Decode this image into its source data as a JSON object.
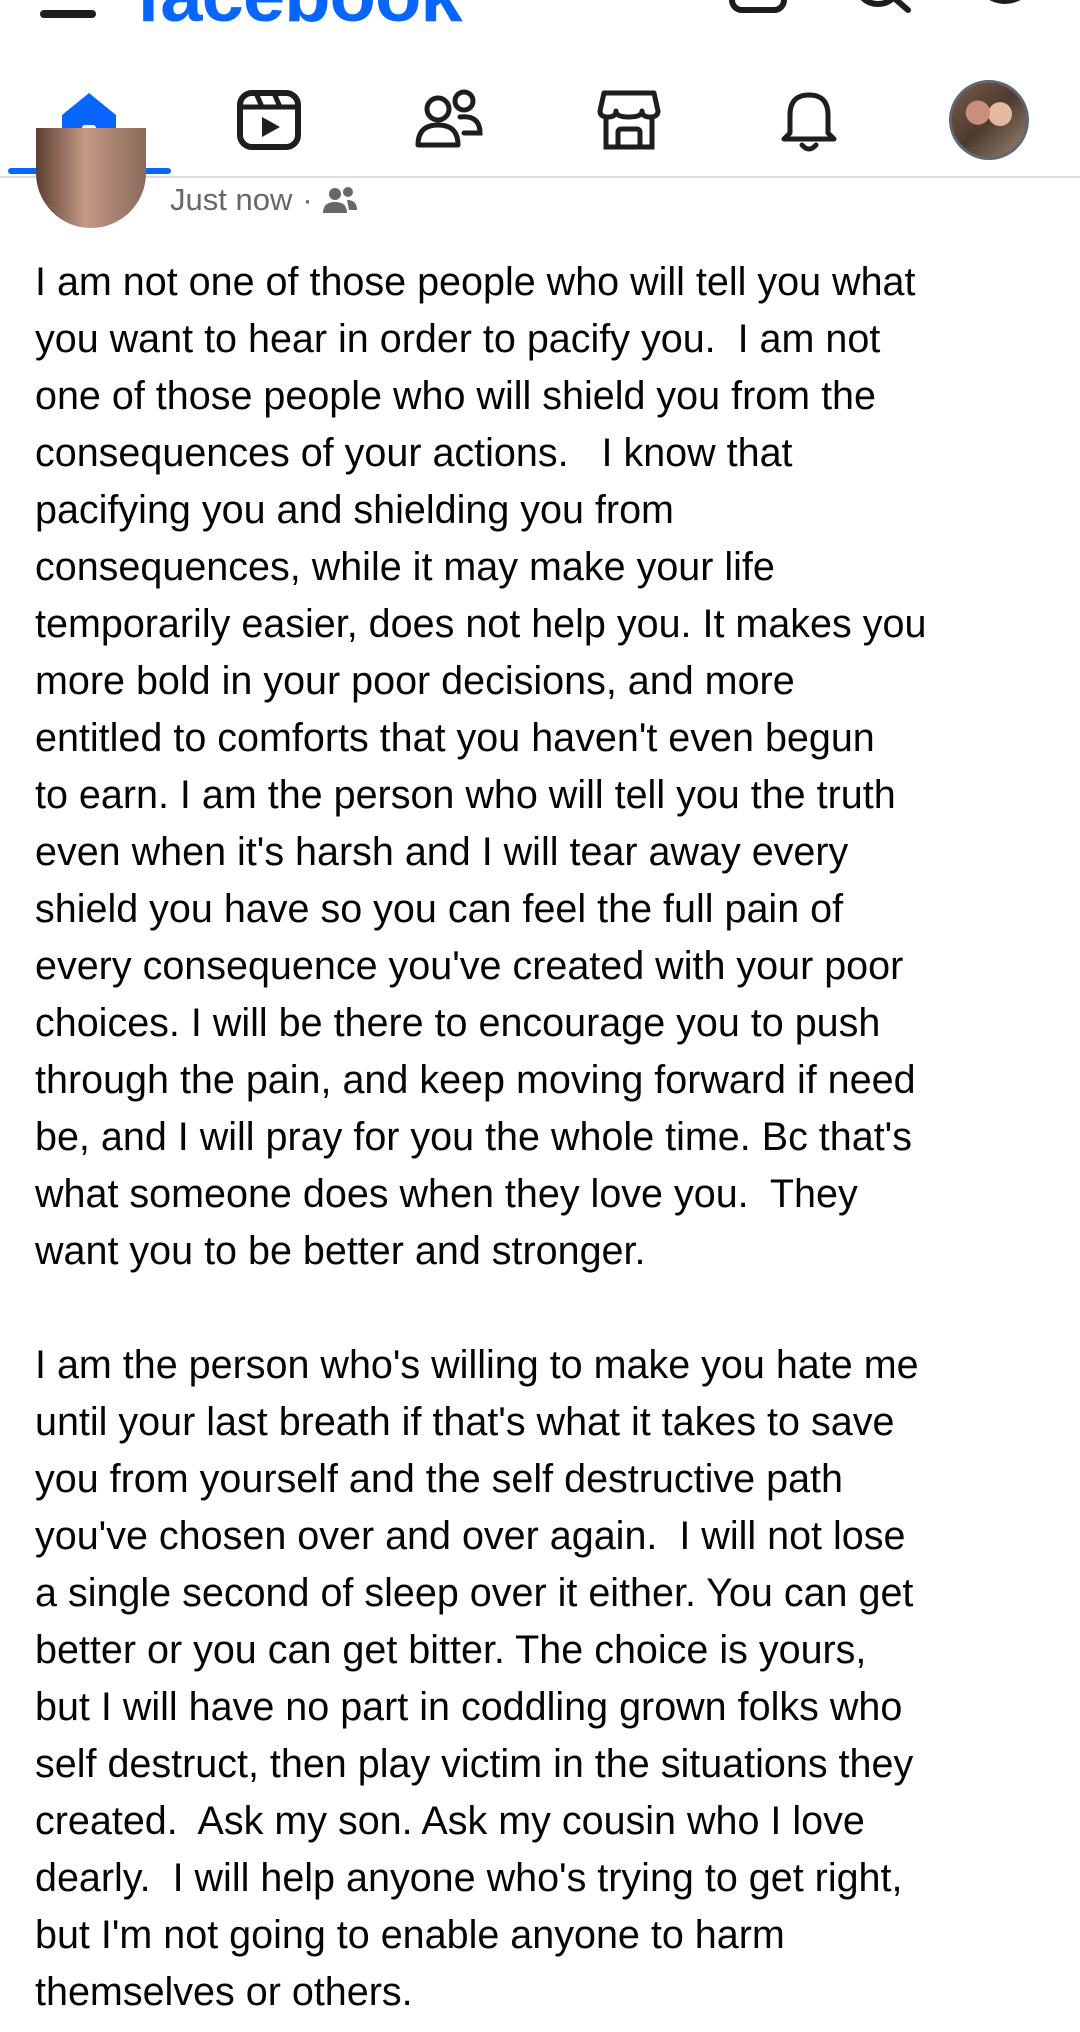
{
  "app": {
    "logo_text": "facebook",
    "brand_color": "#0866ff"
  },
  "top_bar": {
    "icons": [
      "menu-icon",
      "add-icon",
      "search-icon",
      "messenger-icon"
    ]
  },
  "nav": {
    "items": [
      {
        "name": "home",
        "icon": "home-icon",
        "active": true
      },
      {
        "name": "video",
        "icon": "video-icon",
        "active": false
      },
      {
        "name": "friends",
        "icon": "friends-icon",
        "active": false
      },
      {
        "name": "marketplace",
        "icon": "marketplace-icon",
        "active": false
      },
      {
        "name": "notifications",
        "icon": "bell-icon",
        "active": false
      },
      {
        "name": "profile",
        "icon": "profile-avatar",
        "active": false
      }
    ]
  },
  "post": {
    "timestamp": "Just now",
    "separator": "·",
    "audience_icon": "friends-audience-icon",
    "paragraph1_lines": [
      "I am not one of those people who will tell you what",
      "you want to hear in order to pacify you.  I am not",
      "one of those people who will shield you from the",
      "consequences of your actions.   I know that",
      "pacifying you and shielding you from",
      "consequences, while it may make your life",
      "temporarily easier, does not help you. It makes you",
      "more bold in your poor decisions, and more",
      "entitled to comforts that you haven't even begun",
      "to earn. I am the person who will tell you the truth",
      "even when it's harsh and I will tear away every",
      "shield you have so you can feel the full pain of",
      "every consequence you've created with your poor",
      "choices. I will be there to encourage you to push",
      "through the pain, and keep moving forward if need",
      "be, and I will pray for you the whole time. Bc that's",
      "what someone does when they love you.  They",
      "want you to be better and stronger."
    ],
    "paragraph2_lines": [
      "I am the person who's willing to make you hate me",
      "until your last breath if that's what it takes to save",
      "you from yourself and the self destructive path",
      "you've chosen over and over again.  I will not lose",
      "a single second of sleep over it either. You can get",
      "better or you can get bitter. The choice is yours,",
      "but I will have no part in coddling grown folks who",
      "self destruct, then play victim in the situations they",
      "created.  Ask my son. Ask my cousin who I love",
      "dearly.  I will help anyone who's trying to get right,",
      "but I'm not going to enable anyone to harm",
      "themselves or others."
    ]
  }
}
